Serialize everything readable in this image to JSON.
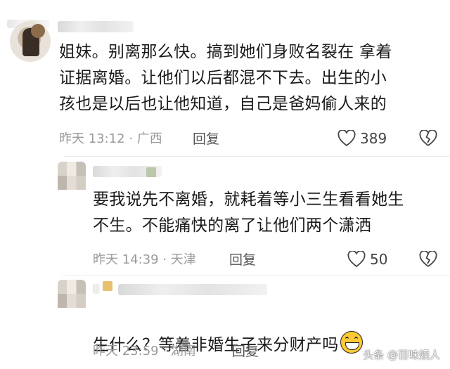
{
  "comments": [
    {
      "text": "姐妹。别离那么快。搞到她们身败名裂在 拿着\n证据离婚。让他们以后都混不下去。出生的小\n孩也是以后也让他知道，自己是爸妈偷人来的",
      "meta": "昨天 13:12 · 广西",
      "reply_label": "回复",
      "likes": "389"
    },
    {
      "text": "要我说先不离婚，就耗着等小三生看看她生\n不生。不能痛快的离了让他们两个潇洒",
      "meta": "昨天 14:39 · 天津",
      "reply_label": "回复",
      "likes": "50"
    },
    {
      "text": "生什么？等着非婚生子来分财产吗",
      "meta": "昨天 23:59 · 湖南",
      "reply_label": "回复",
      "emoji_icon": "grinning-face-emoji"
    }
  ],
  "watermark": {
    "text": "头条 @百味娱人"
  },
  "colors": {
    "text": "#1a1a1a",
    "meta": "#9a9a9a",
    "icon": "#444444"
  }
}
